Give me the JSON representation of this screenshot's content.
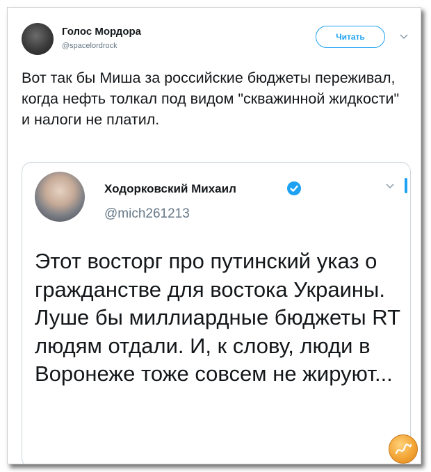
{
  "tweet": {
    "author_name": "Голос Мордора",
    "author_handle": "@spacelordrock",
    "follow_label": "Читать",
    "text": "Вот так бы Миша за российские бюджеты переживал, когда нефть толкал под видом \"скважинной жидкости\" и налоги не платил."
  },
  "quoted_tweet": {
    "author_name": "Ходорковский Михаил",
    "author_handle": "@mich261213",
    "text": "Этот восторг про путинский указ о гражданстве для востока Украины. Луше бы миллиардные бюджеты RT людям отдали. И, к слову, люди в Воронеже тоже совсем не жируют..."
  },
  "icons": {
    "avatar": "avatar",
    "more": "chevron-down-icon",
    "verified": "verified-badge-icon",
    "watermark": "watermark-logo"
  },
  "colors": {
    "accent": "#1da1f2",
    "secondary_text": "#657786",
    "primary_text": "#14171a",
    "border": "#ccd6dd"
  }
}
